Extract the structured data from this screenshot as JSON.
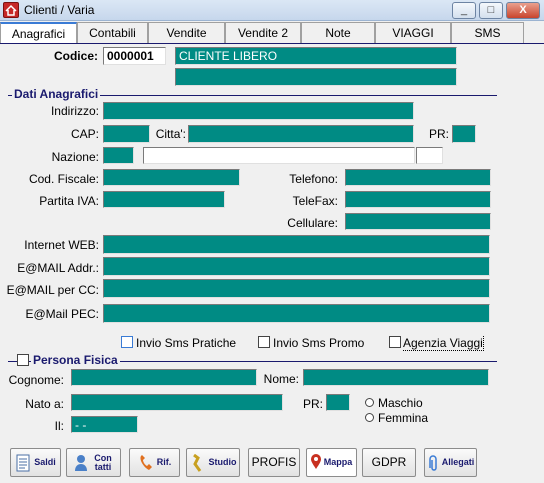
{
  "window": {
    "title": "Clienti / Varia",
    "controls": [
      "_",
      "□",
      "X"
    ]
  },
  "tabs": [
    "Anagrafici",
    "Contabili",
    "Vendite",
    "Vendite 2",
    "Note",
    "VIAGGI",
    "SMS"
  ],
  "codice": {
    "label": "Codice:",
    "value": "0000001",
    "name": "CLIENTE LIBERO"
  },
  "dati": {
    "section": "Dati Anagrafici",
    "indirizzo": "Indirizzo:",
    "cap": "CAP:",
    "citta": "Citta':",
    "pr": "PR:",
    "nazione": "Nazione:",
    "cod_fiscale": "Cod. Fiscale:",
    "telefono": "Telefono:",
    "partita_iva": "Partita IVA:",
    "telefax": "TeleFax:",
    "cellulare": "Cellulare:",
    "internet_web": "Internet WEB:",
    "email": "E@MAIL Addr.:",
    "email_cc": "E@MAIL per CC:",
    "email_pec": "E@Mail PEC:"
  },
  "checks": {
    "sms_pratiche": "Invio Sms Pratiche",
    "sms_promo": "Invio Sms Promo",
    "agenzia": "Agenzia Viaggi"
  },
  "persona": {
    "section": "Persona Fisica",
    "cognome": "Cognome:",
    "nome": "Nome:",
    "nato_a": "Nato a:",
    "pr": "PR:",
    "il": "Il:",
    "il_value": "- -",
    "maschio": "Maschio",
    "femmina": "Femmina"
  },
  "buttons": [
    {
      "label": "Saldi",
      "icon": "document-icon"
    },
    {
      "label": "Con tatti",
      "icon": "contacts-icon"
    },
    {
      "label": "Rif.",
      "icon": "phone-icon"
    },
    {
      "label": "Studio",
      "icon": "studio-icon"
    },
    {
      "label": "PROFIS",
      "icon": ""
    },
    {
      "label": "Mappa",
      "icon": "map-pin-icon"
    },
    {
      "label": "GDPR",
      "icon": ""
    },
    {
      "label": "Allegati",
      "icon": "paperclip-icon"
    }
  ],
  "colors": {
    "field": "#008b84",
    "accent": "#1a1a6e"
  }
}
